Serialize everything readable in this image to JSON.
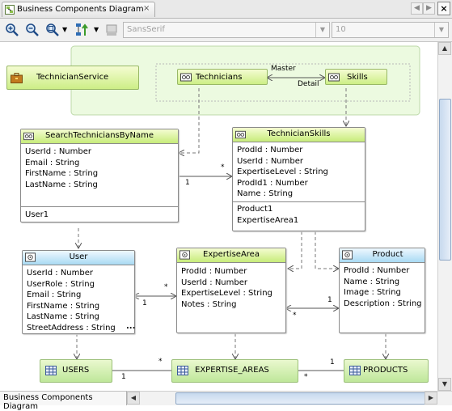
{
  "window": {
    "tab_title": "Business Components Diagram",
    "tab_close": "×",
    "close_button": "×"
  },
  "nav": {
    "back": "◀",
    "forward": "▶",
    "menu": "▼"
  },
  "toolbar": {
    "zoom_in_icon": "zoom-in-icon",
    "zoom_out_icon": "zoom-out-icon",
    "zoom_fit_icon": "zoom-fit-icon",
    "layout_icon": "layout-icon",
    "color_icon": "fill-color-icon",
    "font_family": "SansSerif",
    "font_size": "10",
    "dropdown_arrow": "▼"
  },
  "diagram": {
    "service": {
      "name": "TechnicianService"
    },
    "service_instances": {
      "technicians": "Technicians",
      "skills": "Skills",
      "master_label": "Master",
      "detail_label": "Detail"
    },
    "search_view": {
      "title": "SearchTechniciansByName",
      "attributes": [
        "UserId  : Number",
        "Email  : String",
        "FirstName  : String",
        "LastName  : String"
      ],
      "accessors": [
        "User1"
      ]
    },
    "skills_view": {
      "title": "TechnicianSkills",
      "attributes": [
        "ProdId  : Number",
        "UserId  : Number",
        "ExpertiseLevel  : String",
        "ProdId1  : Number",
        "Name  : String"
      ],
      "accessors": [
        "Product1",
        "ExpertiseArea1"
      ]
    },
    "user_entity": {
      "title": "User",
      "attributes": [
        "UserId  : Number",
        "UserRole  : String",
        "Email  : String",
        "FirstName  : String",
        "LastName  : String",
        "StreetAddress  : String"
      ],
      "more": "..."
    },
    "expertise_entity": {
      "title": "ExpertiseArea",
      "attributes": [
        "ProdId  : Number",
        "UserId  : Number",
        "ExpertiseLevel  : String",
        "Notes  : String"
      ]
    },
    "product_entity": {
      "title": "Product",
      "attributes": [
        "ProdId  : Number",
        "Name  : String",
        "Image  : String",
        "Description  : String"
      ]
    },
    "tables": {
      "users": "USERS",
      "expertise_areas": "EXPERTISE_AREAS",
      "products": "PRODUCTS"
    },
    "multiplicity": {
      "one": "1",
      "many": "*"
    }
  },
  "bottom_tab": {
    "label": "Business Components Diagram"
  },
  "scroll": {
    "up": "▲",
    "down": "▼",
    "left": "◀",
    "right": "▶"
  },
  "colors": {
    "view_header": "#c7ec7a",
    "entity_header": "#a9daf3",
    "service_container": "#ecfae0"
  }
}
